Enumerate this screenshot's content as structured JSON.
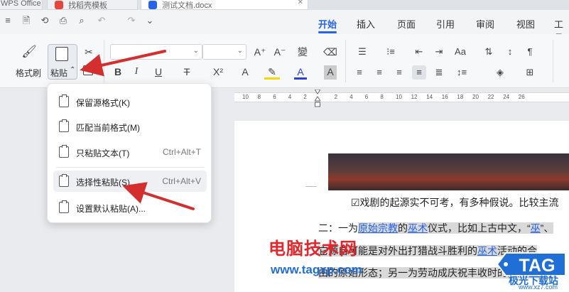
{
  "tabs": [
    {
      "label": "WPS Office"
    },
    {
      "label": "找稻壳模板"
    },
    {
      "label": "测试文档.docx"
    }
  ],
  "menu_tabs": [
    "开始",
    "插入",
    "页面",
    "引用",
    "审阅",
    "视图",
    "工具"
  ],
  "active_menu_tab": "开始",
  "ribbon": {
    "format_painter": "格式刷",
    "paste": "粘贴",
    "paste_caret": "⌃",
    "font_name": "",
    "font_size": ""
  },
  "ruler": {
    "numbers": [
      "10",
      "8",
      "6",
      "4",
      "2",
      "",
      "2",
      "4",
      "6",
      "8",
      "10",
      "12",
      "14",
      "16",
      "18",
      "20",
      "22",
      "24",
      "26"
    ]
  },
  "paste_menu": {
    "items": [
      {
        "label": "保留源格式(K)",
        "shortcut": ""
      },
      {
        "label": "匹配当前格式(M)",
        "shortcut": ""
      },
      {
        "label": "只粘贴文本(T)",
        "shortcut": "Ctrl+Alt+T"
      },
      {
        "label": "选择性粘贴(S)...",
        "shortcut": "Ctrl+Alt+V"
      },
      {
        "label": "设置默认粘贴(A)..."
      }
    ]
  },
  "document": {
    "line1": "☑戏剧的起源实不可考，有多种假说。比较主流",
    "line2_prefix": "二：一为",
    "line2_link1": "原始宗教",
    "line2_mid": "的",
    "line2_link2": "巫术",
    "line2_suffix": "仪式，比如上古中文，“",
    "line2_link3": "巫",
    "line2_end": "”、",
    "line3_prefix": "它源自可能是对外出打猎战斗胜利的",
    "line3_link": "巫术",
    "line3_suffix": "活动的合",
    "line4": "由的原始形态；另一为劳动成庆祝丰收时的即兴歌舞表"
  },
  "watermark": {
    "title": "电脑技术网",
    "url": "www.tagxp.com",
    "badge": "TAG",
    "sub": "极光下载站",
    "sub_url": "www.xz7.com"
  },
  "colors": {
    "accent": "#2563eb",
    "arrow": "#d32f2f",
    "wm_red": "#e3262b",
    "wm_blue": "#1f6fd6"
  }
}
